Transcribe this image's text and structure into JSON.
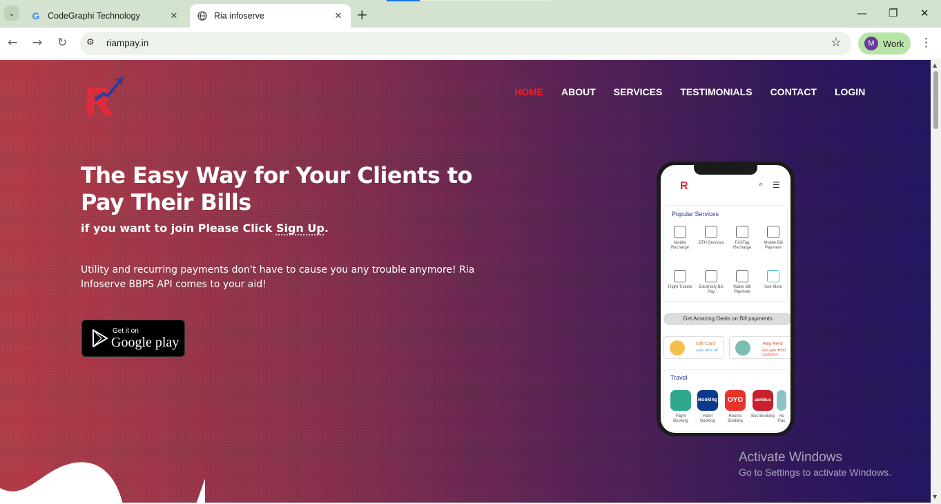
{
  "browser": {
    "tabs": [
      {
        "title": "CodeGraphi Technology",
        "favicon": "google-g",
        "active": false
      },
      {
        "title": "Ria infoserve",
        "favicon": "globe-icon",
        "active": true
      }
    ],
    "url": "riampay.in",
    "profile_initial": "M",
    "profile_label": "Work"
  },
  "site": {
    "nav": [
      "HOME",
      "ABOUT",
      "SERVICES",
      "TESTIMONIALS",
      "CONTACT",
      "LOGIN"
    ],
    "headline": "The Easy Way for Your Clients to Pay Their Bills",
    "sub_prefix": "if you want to join Please Click ",
    "sub_link": "Sign Up",
    "sub_suffix": ".",
    "description": "Utility and recurring payments don't have to cause you any trouble anymore! Ria Infoserve BBPS API comes to your aid!",
    "store_small": "Get it on",
    "store_big": "Google play"
  },
  "phone": {
    "logo": "R",
    "popular_title": "Popular Services",
    "services": [
      "Mobile Recharge",
      "DTH Services",
      "FASTag Recharge",
      "Mobile Bill Payment",
      "Flight Tickets",
      "Electricity Bill Pay",
      "Water Bill Payment",
      "See More"
    ],
    "deal_banner": "Get Amazing Deals on Bill payments",
    "promo1_title": "Gift Card",
    "promo1_sub": "Upto 40% off",
    "promo2_title": "Pay Rent",
    "promo2_sub": "Get upto ₹500 Cashback",
    "travel_title": "Travel",
    "travel": [
      {
        "label": "Flight Booking",
        "badge": ""
      },
      {
        "label": "Hotel Booking",
        "badge": "Booking"
      },
      {
        "label": "Rooms Booking",
        "badge": "OYO"
      },
      {
        "label": "Bus Booking",
        "badge": "abhiBus"
      },
      {
        "label": "Ho Pac",
        "badge": ""
      }
    ]
  },
  "os": {
    "watermark_title": "Activate Windows",
    "watermark_sub": "Go to Settings to activate Windows."
  },
  "colors": {
    "nav_active": "#ff1a1a",
    "hero_left": "#b8404a",
    "hero_right": "#251763"
  }
}
